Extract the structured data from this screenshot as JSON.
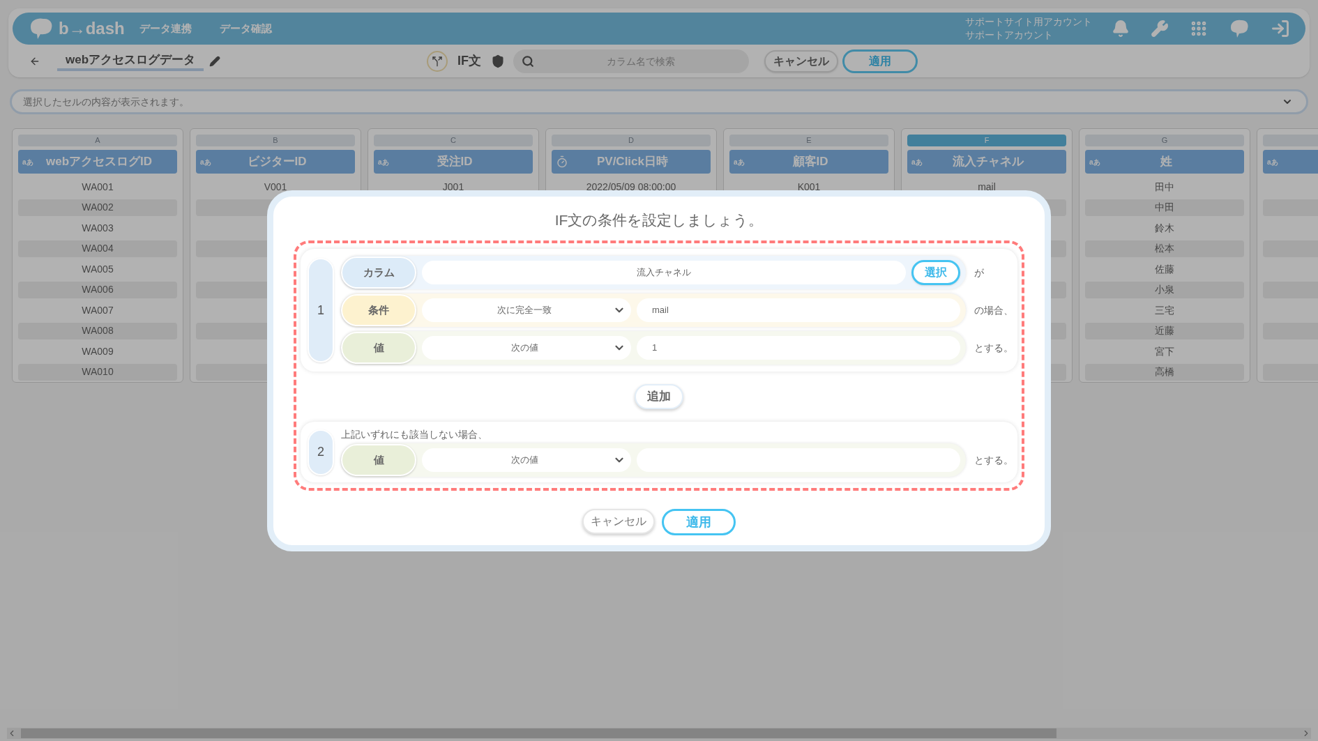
{
  "header": {
    "logo": "b→dash",
    "nav": [
      {
        "label": "データ連携"
      },
      {
        "label": "データ確認"
      }
    ],
    "account": [
      "サポートサイト用アカウント",
      "サポートアカウント"
    ]
  },
  "toolbar": {
    "title": "webアクセスログデータ",
    "mode": "IF文",
    "search_placeholder": "カラム名で検索",
    "cancel": "キャンセル",
    "apply": "適用"
  },
  "cell_bar": {
    "placeholder": "選択したセルの内容が表示されます。"
  },
  "columns": [
    {
      "letter": "A",
      "name": "webアクセスログID",
      "kind": "text",
      "type_label": "aあ",
      "selected": false,
      "cells": [
        "WA001",
        "WA002",
        "WA003",
        "WA004",
        "WA005",
        "WA006",
        "WA007",
        "WA008",
        "WA009",
        "WA010"
      ]
    },
    {
      "letter": "B",
      "name": "ビジターID",
      "kind": "text",
      "type_label": "aあ",
      "selected": false,
      "cells": [
        "V001"
      ]
    },
    {
      "letter": "C",
      "name": "受注ID",
      "kind": "text",
      "type_label": "aあ",
      "selected": false,
      "cells": [
        "J001"
      ]
    },
    {
      "letter": "D",
      "name": "PV/Click日時",
      "kind": "datetime",
      "selected": false,
      "cells": [
        "2022/05/09 08:00:00"
      ]
    },
    {
      "letter": "E",
      "name": "顧客ID",
      "kind": "text",
      "type_label": "aあ",
      "selected": false,
      "cells": [
        "K001"
      ]
    },
    {
      "letter": "F",
      "name": "流入チャネル",
      "kind": "text",
      "type_label": "aあ",
      "selected": true,
      "cells": [
        "mail"
      ]
    },
    {
      "letter": "G",
      "name": "姓",
      "kind": "text",
      "type_label": "aあ",
      "selected": false,
      "cells": [
        "田中",
        "中田",
        "鈴木",
        "松本",
        "佐藤",
        "小泉",
        "三宅",
        "近藤",
        "宮下",
        "高橋"
      ]
    },
    {
      "kind": "text",
      "type_label": "aあ",
      "selected": false
    }
  ],
  "dialog": {
    "title": "IF文の条件を設定しましょう。",
    "conditions": [
      {
        "number": "1",
        "rows": [
          {
            "kind": "column",
            "label": "カラム",
            "value": "流入チャネル",
            "button": "選択",
            "suffix": "が"
          },
          {
            "kind": "condition",
            "label": "条件",
            "select": "次に完全一致",
            "value": "mail",
            "suffix": "の場合、"
          },
          {
            "kind": "value",
            "label": "値",
            "select": "次の値",
            "value": "1",
            "suffix": "とする。"
          }
        ]
      }
    ],
    "add_button": "追加",
    "otherwise": {
      "number": "2",
      "note": "上記いずれにも該当しない場合、",
      "rows": [
        {
          "kind": "value",
          "label": "値",
          "select": "次の値",
          "suffix": "とする。"
        }
      ]
    },
    "cancel": "キャンセル",
    "apply": "適用"
  }
}
